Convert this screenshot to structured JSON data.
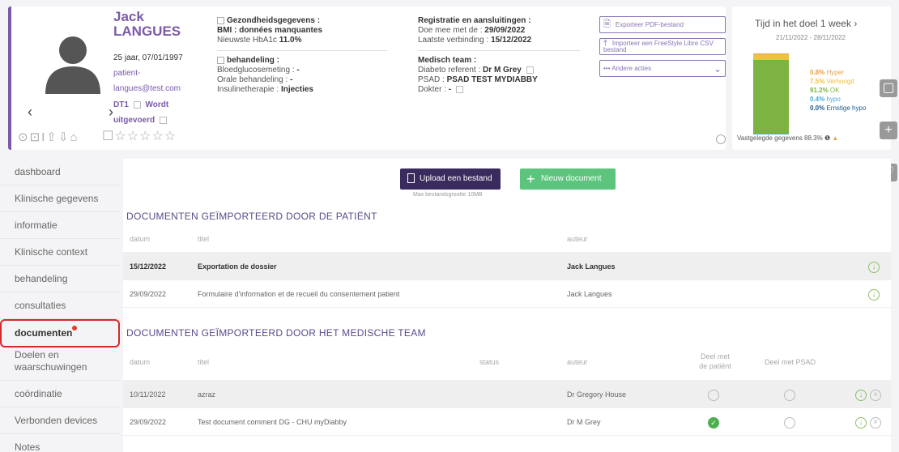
{
  "patient": {
    "first_name": "Jack",
    "last_name": "LANGUES",
    "age_dob": "25 jaar, 07/01/1997",
    "email": "patient-langues@test.com",
    "dt": "DT1",
    "status": "Wordt uitgevoerd",
    "icons_row": "⊙⊡I⇧⇩⌂",
    "stars": "☐☆☆☆☆☆"
  },
  "health": {
    "title": "Gezondheidsgegevens :",
    "bmi": "BMI : données manquantes",
    "hba1c_label": "Nieuwste HbA1c",
    "hba1c_value": "11.0%",
    "treatment_title": "behandeling :",
    "glucose_label": "Bloedglucosemeting :",
    "glucose_value": "-",
    "oral_label": "Orale behandeling :",
    "oral_value": "-",
    "insulin_label": "Insulinetherapie :",
    "insulin_value": "Injecties"
  },
  "registration": {
    "title": "Registratie en aansluitingen :",
    "joined_label": "Doe mee met de :",
    "joined_value": "29/09/2022",
    "last_conn_label": "Laatste verbinding :",
    "last_conn_value": "15/12/2022",
    "team_title": "Medisch team :",
    "referent_label": "Diabeto referent :",
    "referent_value": "Dr M Grey",
    "psad_label": "PSAD :",
    "psad_value": "PSAD TEST MYDIABBY",
    "doctor_label": "Dokter :",
    "doctor_value": "-"
  },
  "actions": {
    "export_pdf": "Exporteer PDF-bestand",
    "import_csv": "Importeer een FreeStyle Libre CSV bestand",
    "other_actions": "Andere acties"
  },
  "target": {
    "title": "Tijd in het doel 1 week",
    "dates": "21/11/2022 - 28/11/2022",
    "legend": [
      {
        "value": "0.8%",
        "label": "Hyper",
        "color": "#e8a040"
      },
      {
        "value": "7.5%",
        "label": "Verhoogd",
        "color": "#f0c040"
      },
      {
        "value": "91.2%",
        "label": "OK",
        "color": "#7cb342"
      },
      {
        "value": "0.4%",
        "label": "hypo",
        "color": "#4aa8d8"
      },
      {
        "value": "0.0%",
        "label": "Ernstige hypo",
        "color": "#1e5a8a"
      }
    ],
    "footer": "Vastgelegde gegevens 88.3%"
  },
  "sidebar": {
    "items": [
      {
        "label": "dashboard"
      },
      {
        "label": "Klinische gegevens"
      },
      {
        "label": "informatie"
      },
      {
        "label": "Klinische context"
      },
      {
        "label": "behandeling"
      },
      {
        "label": "consultaties"
      },
      {
        "label": "documenten"
      },
      {
        "label": "Doelen en waarschuwingen"
      },
      {
        "label": "coördinatie"
      },
      {
        "label": "Verbonden devices"
      },
      {
        "label": "Notes"
      }
    ]
  },
  "main": {
    "upload_button": "Upload een bestand",
    "new_button": "Nieuw document",
    "upload_note": "Max bestandsgrootte 10MB",
    "patient_section": {
      "title": "DOCUMENTEN GEÏMPORTEERD DOOR DE PATIËNT",
      "headers": {
        "date": "datum",
        "title": "titel",
        "author": "auteur"
      },
      "rows": [
        {
          "date": "15/12/2022",
          "title": "Exportation de dossier",
          "author": "Jack Langues"
        },
        {
          "date": "29/09/2022",
          "title": "Formulaire d'information et de recueil du consentement patient",
          "author": "Jack Langues"
        }
      ]
    },
    "team_section": {
      "title": "DOCUMENTEN GEÏMPORTEERD DOOR HET MEDISCHE TEAM",
      "headers": {
        "date": "datum",
        "title": "titel",
        "status": "status",
        "author": "auteur",
        "share_patient": "Deel met de patiënt",
        "share_psad": "Deel met PSAD"
      },
      "rows": [
        {
          "date": "10/11/2022",
          "title": "azraz",
          "author": "Dr Gregory House"
        },
        {
          "date": "29/09/2022",
          "title": "Test document comment DG - CHU myDiabby",
          "author": "Dr M Grey"
        }
      ]
    }
  }
}
